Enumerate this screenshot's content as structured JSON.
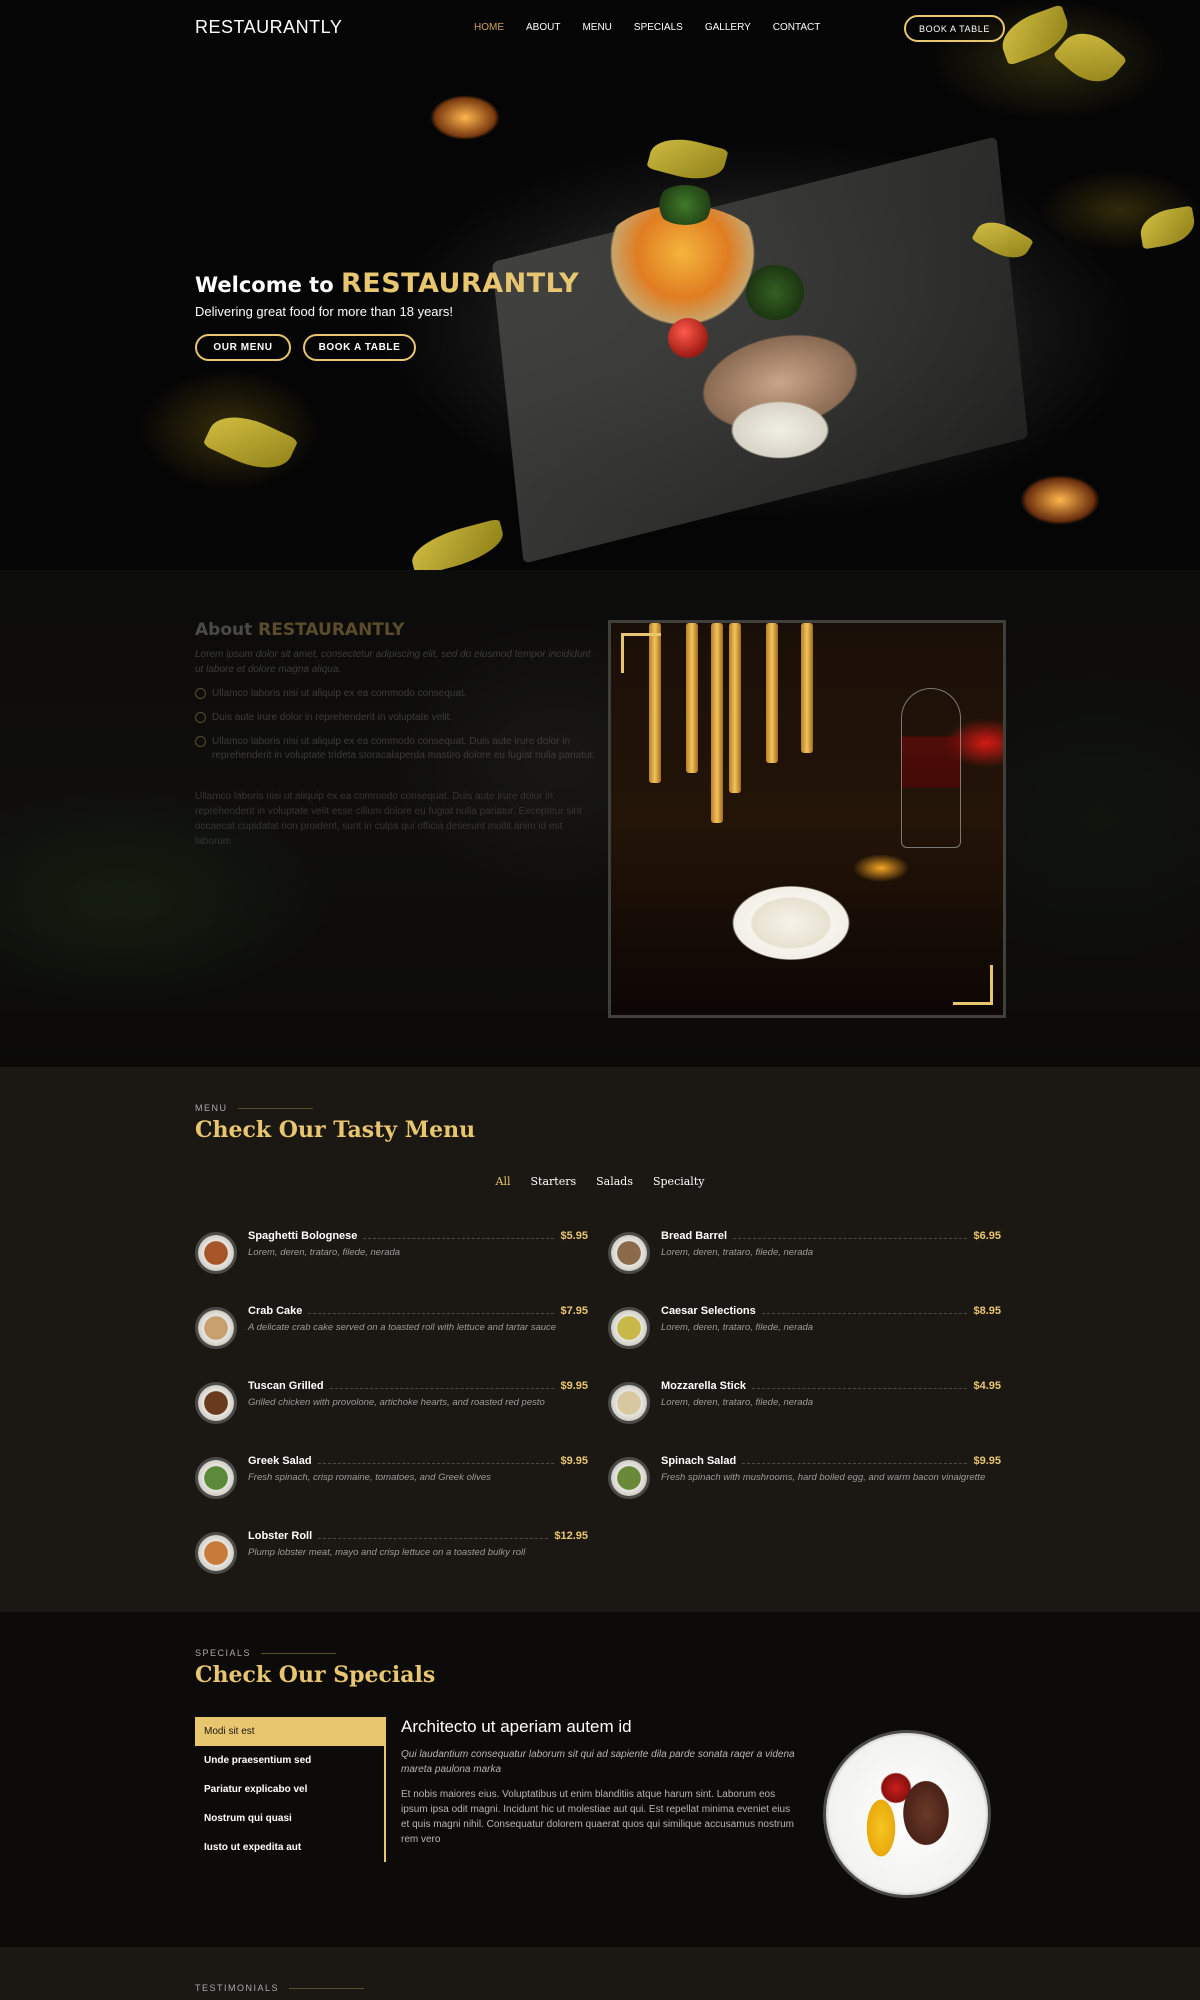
{
  "header": {
    "logo": "RESTAURANTLY",
    "nav": [
      {
        "label": "HOME",
        "active": true
      },
      {
        "label": "ABOUT",
        "active": false
      },
      {
        "label": "MENU",
        "active": false
      },
      {
        "label": "SPECIALS",
        "active": false
      },
      {
        "label": "GALLERY",
        "active": false
      },
      {
        "label": "CONTACT",
        "active": false
      }
    ],
    "book_label": "BOOK A TABLE"
  },
  "hero": {
    "welcome": "Welcome to",
    "brand": "RESTAURANTLY",
    "subtitle": "Delivering great food for more than 18 years!",
    "menu_btn": "OUR MENU",
    "book_btn": "BOOK A TABLE"
  },
  "about": {
    "title_prefix": "About",
    "title_brand": "RESTAURANTLY",
    "intro": "Lorem ipsum dolor sit amet, consectetur adipiscing elit, sed do eiusmod tempor incididunt ut labore et dolore magna aliqua.",
    "list": [
      "Ullamco laboris nisi ut aliquip ex ea commodo consequat.",
      "Duis aute irure dolor in reprehenderit in voluptate velit.",
      "Ullamco laboris nisi ut aliquip ex ea commodo consequat. Duis aute irure dolor in reprehenderit in voluptate trideta storacalaperda mastiro dolore eu fugiat nulla pariatur."
    ],
    "outro": "Ullamco laboris nisi ut aliquip ex ea commodo consequat. Duis aute irure dolor in reprehenderit in voluptate velit esse cillum dolore eu fugiat nulla pariatur. Excepteur sint occaecat cupidatat non proident, sunt in culpa qui officia deserunt mollit anim id est laborum"
  },
  "menu": {
    "label": "MENU",
    "title": "Check Our Tasty Menu",
    "filters": [
      {
        "label": "All",
        "active": true
      },
      {
        "label": "Starters",
        "active": false
      },
      {
        "label": "Salads",
        "active": false
      },
      {
        "label": "Specialty",
        "active": false
      }
    ],
    "items": [
      {
        "name": "Spaghetti Bolognese",
        "price": "$5.95",
        "desc": "Lorem, deren, trataro, filede, nerada",
        "img_color": "#a8552a"
      },
      {
        "name": "Bread Barrel",
        "price": "$6.95",
        "desc": "Lorem, deren, trataro, filede, nerada",
        "img_color": "#8a6a4a"
      },
      {
        "name": "Crab Cake",
        "price": "$7.95",
        "desc": "A delicate crab cake served on a toasted roll with lettuce and tartar sauce",
        "img_color": "#c8a070"
      },
      {
        "name": "Caesar Selections",
        "price": "$8.95",
        "desc": "Lorem, deren, trataro, filede, nerada",
        "img_color": "#c8b84a"
      },
      {
        "name": "Tuscan Grilled",
        "price": "$9.95",
        "desc": "Grilled chicken with provolone, artichoke hearts, and roasted red pesto",
        "img_color": "#6a3a1e"
      },
      {
        "name": "Mozzarella Stick",
        "price": "$4.95",
        "desc": "Lorem, deren, trataro, filede, nerada",
        "img_color": "#d8c8a0"
      },
      {
        "name": "Greek Salad",
        "price": "$9.95",
        "desc": "Fresh spinach, crisp romaine, tomatoes, and Greek olives",
        "img_color": "#5a8a3a"
      },
      {
        "name": "Spinach Salad",
        "price": "$9.95",
        "desc": "Fresh spinach with mushrooms, hard boiled egg, and warm bacon vinaigrette",
        "img_color": "#6a8a3a"
      },
      {
        "name": "Lobster Roll",
        "price": "$12.95",
        "desc": "Plump lobster meat, mayo and crisp lettuce on a toasted bulky roll",
        "img_color": "#c87a3a"
      }
    ]
  },
  "specials": {
    "label": "SPECIALS",
    "title": "Check Our Specials",
    "tabs": [
      {
        "label": "Modi sit est",
        "active": true
      },
      {
        "label": "Unde praesentium sed",
        "active": false
      },
      {
        "label": "Pariatur explicabo vel",
        "active": false
      },
      {
        "label": "Nostrum qui quasi",
        "active": false
      },
      {
        "label": "Iusto ut expedita aut",
        "active": false
      }
    ],
    "heading": "Architecto ut aperiam autem id",
    "italic": "Qui laudantium consequatur laborum sit qui ad sapiente dila parde sonata raqer a videna mareta paulona marka",
    "body": "Et nobis maiores eius. Voluptatibus ut enim blanditiis atque harum sint. Laborum eos ipsum ipsa odit magni. Incidunt hic ut molestiae aut qui. Est repellat minima eveniet eius et quis magni nihil. Consequatur dolorem quaerat quos qui similique accusamus nostrum rem vero"
  },
  "testimonials": {
    "label": "TESTIMONIALS"
  },
  "colors": {
    "accent": "#e8c670",
    "nav_active": "#cda45e",
    "menu_bg": "#1b1813",
    "page_bg": "#0c0b09"
  }
}
